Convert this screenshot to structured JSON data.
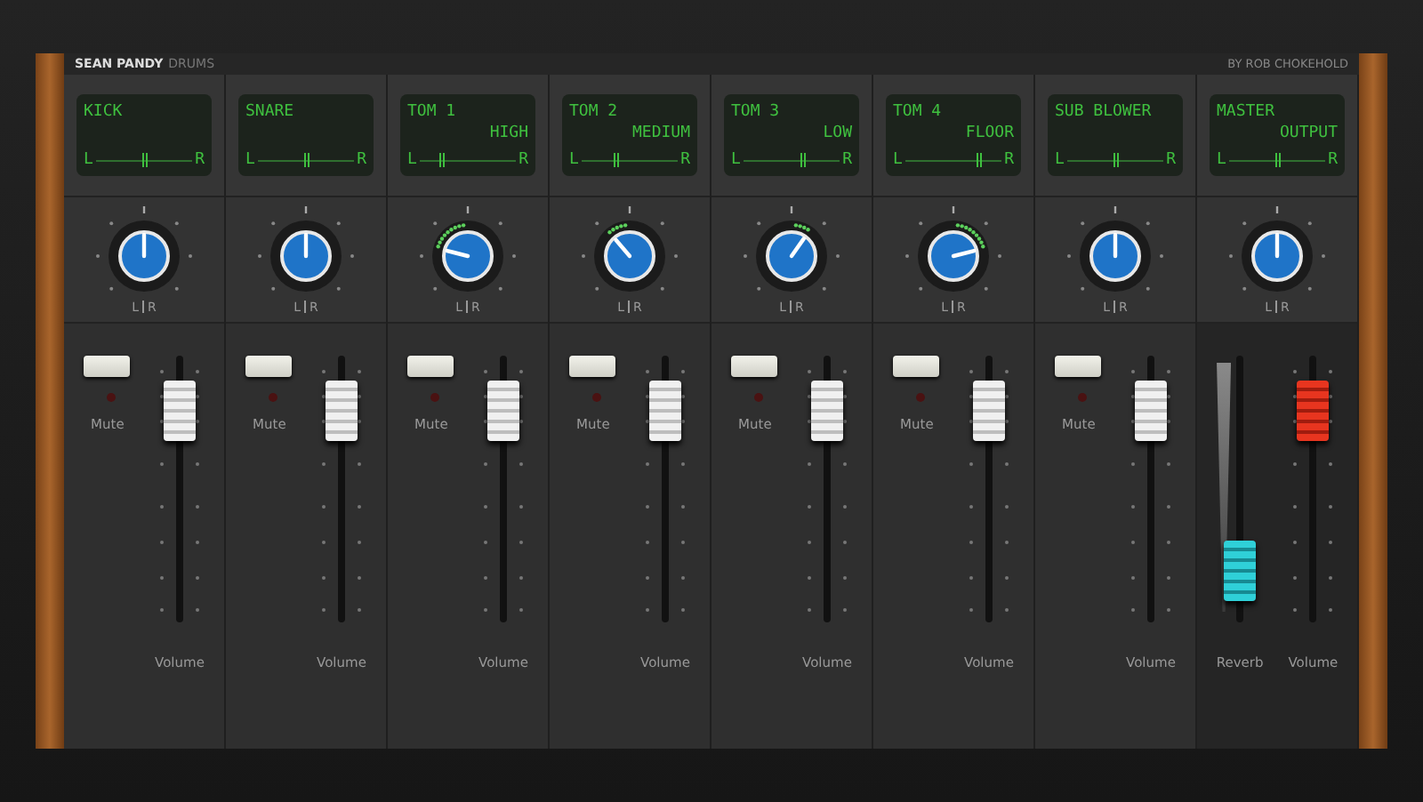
{
  "header": {
    "title": "SEAN PANDY",
    "subtitle": "DRUMS",
    "credit": "BY ROB CHOKEHOLD"
  },
  "channels": [
    {
      "kind": "channel",
      "name": "KICK",
      "display_left": "L",
      "display_right": "R",
      "pan": {
        "level": 0.5,
        "left": "L",
        "right": "R"
      },
      "mute": {
        "label": "Mute",
        "muted": false
      },
      "faders": [
        {
          "kind": "volume",
          "label": "Volume",
          "level": 0.88
        }
      ]
    },
    {
      "kind": "channel",
      "name": "SNARE",
      "display_left": "L",
      "display_right": "R",
      "pan": {
        "level": 0.5,
        "left": "L",
        "right": "R"
      },
      "mute": {
        "label": "Mute",
        "muted": false
      },
      "faders": [
        {
          "kind": "volume",
          "label": "Volume",
          "level": 0.88
        }
      ]
    },
    {
      "kind": "channel",
      "name": "TOM 1",
      "detail": "HIGH",
      "display_left": "L",
      "display_right": "R",
      "pan": {
        "level": 0.22,
        "left": "L",
        "right": "R"
      },
      "mute": {
        "label": "Mute",
        "muted": false
      },
      "faders": [
        {
          "kind": "volume",
          "label": "Volume",
          "level": 0.88
        }
      ]
    },
    {
      "kind": "channel",
      "name": "TOM 2",
      "detail": "MEDIUM",
      "display_left": "L",
      "display_right": "R",
      "pan": {
        "level": 0.35,
        "left": "L",
        "right": "R"
      },
      "mute": {
        "label": "Mute",
        "muted": false
      },
      "faders": [
        {
          "kind": "volume",
          "label": "Volume",
          "level": 0.88
        }
      ]
    },
    {
      "kind": "channel",
      "name": "TOM 3",
      "detail": "LOW",
      "display_left": "L",
      "display_right": "R",
      "pan": {
        "level": 0.63,
        "left": "L",
        "right": "R"
      },
      "mute": {
        "label": "Mute",
        "muted": false
      },
      "faders": [
        {
          "kind": "volume",
          "label": "Volume",
          "level": 0.88
        }
      ]
    },
    {
      "kind": "channel",
      "name": "TOM 4",
      "detail": "FLOOR",
      "display_left": "L",
      "display_right": "R",
      "pan": {
        "level": 0.78,
        "left": "L",
        "right": "R"
      },
      "mute": {
        "label": "Mute",
        "muted": false
      },
      "faders": [
        {
          "kind": "volume",
          "label": "Volume",
          "level": 0.88
        }
      ]
    },
    {
      "kind": "channel",
      "name": "SUB BLOWER",
      "display_left": "L",
      "display_right": "R",
      "pan": {
        "level": 0.5,
        "left": "L",
        "right": "R"
      },
      "mute": {
        "label": "Mute",
        "muted": false
      },
      "faders": [
        {
          "kind": "volume",
          "label": "Volume",
          "level": 0.88
        }
      ]
    },
    {
      "kind": "master",
      "name": "MASTER",
      "detail": "OUTPUT",
      "display_left": "L",
      "display_right": "R",
      "pan": {
        "level": 0.5,
        "left": "L",
        "right": "R"
      },
      "faders": [
        {
          "kind": "reverb",
          "label": "Reverb",
          "level": 0.1
        },
        {
          "kind": "volume",
          "label": "Volume",
          "level": 0.88
        }
      ]
    }
  ]
}
